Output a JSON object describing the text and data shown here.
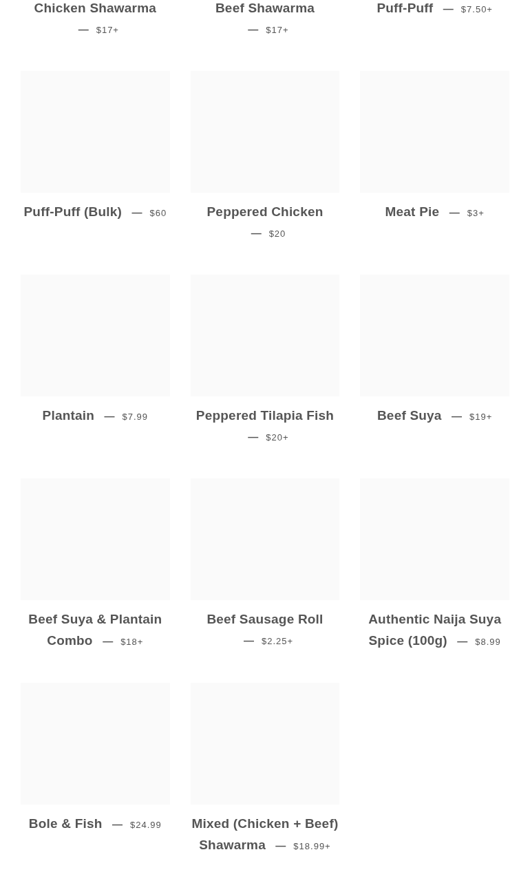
{
  "products": [
    {
      "title": "Chicken Shawarma",
      "price": "$17+",
      "image": false
    },
    {
      "title": "Beef Shawarma",
      "price": "$17+",
      "image": false
    },
    {
      "title": "Puff-Puff",
      "price": "$7.50+",
      "image": false
    },
    {
      "title": "Puff-Puff (Bulk)",
      "price": "$60",
      "image": true
    },
    {
      "title": "Peppered Chicken",
      "price": "$20",
      "image": true
    },
    {
      "title": "Meat Pie",
      "price": "$3+",
      "image": true
    },
    {
      "title": "Plantain",
      "price": "$7.99",
      "image": true
    },
    {
      "title": "Peppered Tilapia Fish",
      "price": "$20+",
      "image": true
    },
    {
      "title": "Beef Suya",
      "price": "$19+",
      "image": true
    },
    {
      "title": "Beef Suya & Plantain Combo",
      "price": "$18+",
      "image": true
    },
    {
      "title": "Beef Sausage Roll",
      "price": "$2.25+",
      "image": true
    },
    {
      "title": "Authentic Naija Suya Spice (100g)",
      "price": "$8.99",
      "image": true
    },
    {
      "title": "Bole & Fish",
      "price": "$24.99",
      "image": true
    },
    {
      "title": "Mixed (Chicken + Beef) Shawarma",
      "price": "$18.99+",
      "image": true
    }
  ],
  "separator": "—"
}
